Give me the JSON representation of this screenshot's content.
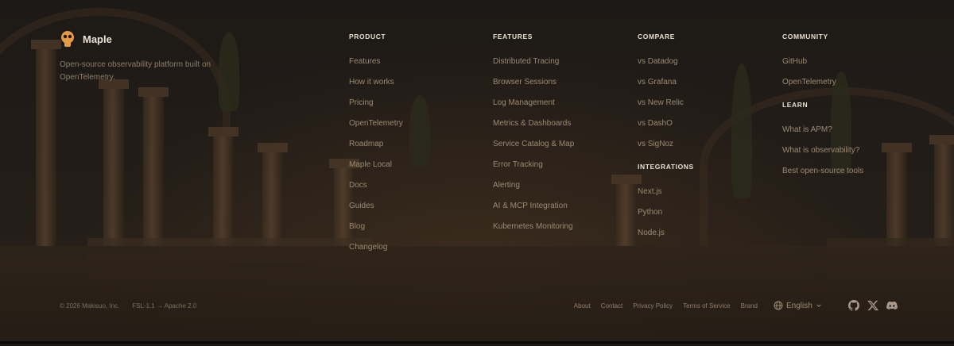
{
  "brand": {
    "name": "Maple",
    "tagline": "Open-source observability platform built on OpenTelemetry.",
    "accent": "#e79a45"
  },
  "columns": [
    {
      "heading": "PRODUCT",
      "links": [
        "Features",
        "How it works",
        "Pricing",
        "OpenTelemetry",
        "Roadmap",
        "Maple Local",
        "Docs",
        "Guides",
        "Blog",
        "Changelog"
      ]
    },
    {
      "heading": "FEATURES",
      "links": [
        "Distributed Tracing",
        "Browser Sessions",
        "Log Management",
        "Metrics & Dashboards",
        "Service Catalog & Map",
        "Error Tracking",
        "Alerting",
        "AI & MCP Integration",
        "Kubernetes Monitoring"
      ]
    },
    {
      "heading": "COMPARE",
      "links": [
        "vs Datadog",
        "vs Grafana",
        "vs New Relic",
        "vs DashO",
        "vs SigNoz"
      ],
      "subheading": "INTEGRATIONS",
      "sublinks": [
        "Next.js",
        "Python",
        "Node.js"
      ]
    },
    {
      "heading": "COMMUNITY",
      "links": [
        "GitHub",
        "OpenTelemetry"
      ],
      "subheading": "LEARN",
      "sublinks": [
        "What is APM?",
        "What is observability?",
        "Best open-source tools"
      ]
    }
  ],
  "bottom": {
    "copyright": "© 2026 Makisuo, Inc.",
    "license": "FSL-1.1 → Apache 2.0",
    "links": [
      "About",
      "Contact",
      "Privacy Policy",
      "Terms of Service",
      "Brand"
    ],
    "language": "English",
    "socials": [
      "github-icon",
      "x-icon",
      "discord-icon"
    ]
  }
}
